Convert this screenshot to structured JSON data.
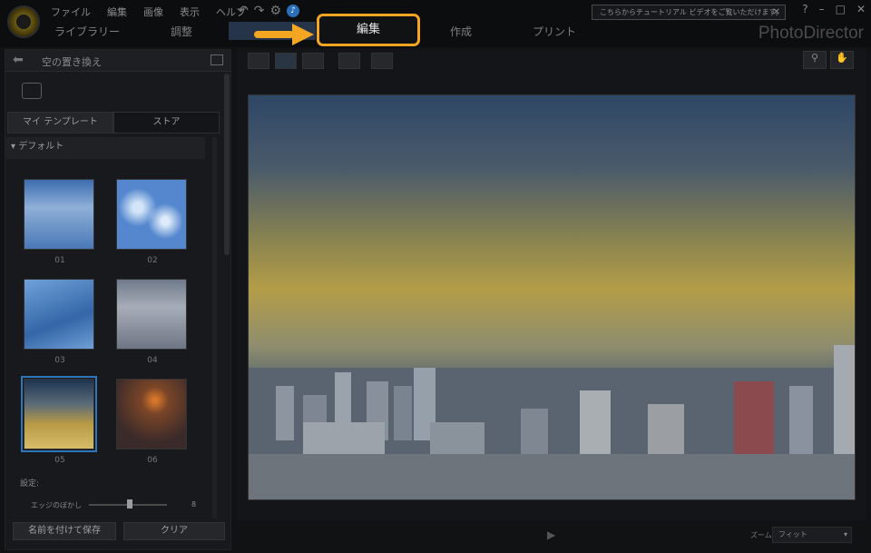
{
  "menu": [
    "ファイル",
    "編集",
    "画像",
    "表示",
    "ヘルプ"
  ],
  "tabs": {
    "library": "ライブラリー",
    "adjust": "調整",
    "edit": "編集",
    "create": "作成",
    "print": "プリント"
  },
  "tutorial_text": "こちらからチュートリアル ビデオをご覧いただけます。",
  "brand": "PhotoDirector",
  "window_controls": [
    "?",
    "–",
    "□",
    "✕"
  ],
  "panel": {
    "title": "空の置き換え",
    "subtabs": [
      "マイ テンプレート",
      "ストア"
    ],
    "section": "デフォルト",
    "thumbnails": [
      "01",
      "02",
      "03",
      "04",
      "05",
      "06"
    ],
    "selected_thumbnail": "05",
    "settings_label": "設定:",
    "edge_label": "エッジのぼかし",
    "edge_value": "8",
    "edge_level": 0.55,
    "save_as_label": "名前を付けて保存",
    "clear_label": "クリア"
  },
  "viewer": {
    "zoom_label": "ズーム:",
    "zoom_value": "フィット"
  },
  "colors": {
    "highlight": "#f4a623",
    "accent": "#2e77bb"
  }
}
